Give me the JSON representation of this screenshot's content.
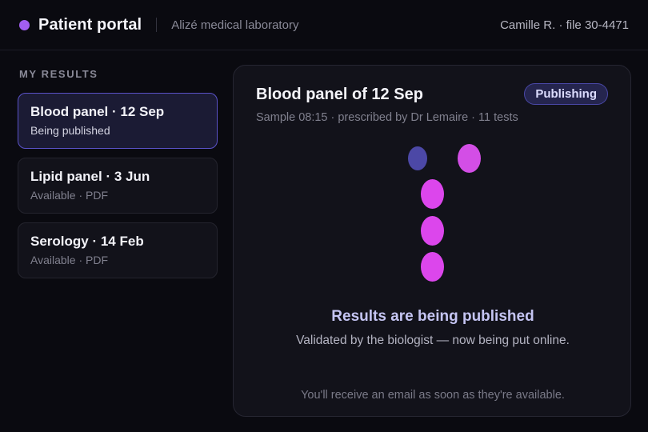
{
  "header": {
    "title": "Patient portal",
    "lab_name": "Alizé medical laboratory",
    "user": "Camille R. · file 30-4471",
    "accent_color": "#a25ef0"
  },
  "sidebar": {
    "heading": "MY RESULTS",
    "items": [
      {
        "title": "Blood panel · 12 Sep",
        "subtitle": "Being published",
        "selected": true
      },
      {
        "title": "Lipid panel · 3 Jun",
        "subtitle": "Available · PDF",
        "selected": false
      },
      {
        "title": "Serology · 14 Feb",
        "subtitle": "Available · PDF",
        "selected": false
      }
    ]
  },
  "main": {
    "title": "Blood panel of 12 Sep",
    "badge": "Publishing",
    "meta": "Sample 08:15 · prescribed by Dr Lemaire · 11 tests",
    "status_heading": "Results are being published",
    "status_text": "Validated by the biologist — now being put online.",
    "note": "You'll receive an email as soon as they're available."
  }
}
